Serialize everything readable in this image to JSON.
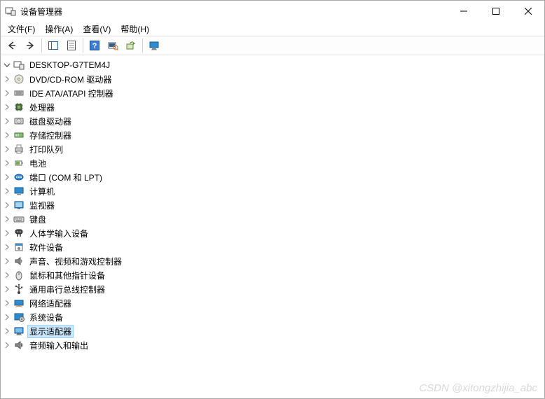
{
  "window": {
    "title": "设备管理器"
  },
  "menu": {
    "file": "文件(F)",
    "action": "操作(A)",
    "view": "查看(V)",
    "help": "帮助(H)"
  },
  "tree": {
    "root": "DESKTOP-G7TEM4J",
    "items": [
      {
        "label": "DVD/CD-ROM 驱动器",
        "icon": "disc"
      },
      {
        "label": "IDE ATA/ATAPI 控制器",
        "icon": "ide"
      },
      {
        "label": "处理器",
        "icon": "cpu"
      },
      {
        "label": "磁盘驱动器",
        "icon": "hdd"
      },
      {
        "label": "存储控制器",
        "icon": "storage"
      },
      {
        "label": "打印队列",
        "icon": "printer"
      },
      {
        "label": "电池",
        "icon": "battery"
      },
      {
        "label": "端口 (COM 和 LPT)",
        "icon": "port"
      },
      {
        "label": "计算机",
        "icon": "computer"
      },
      {
        "label": "监视器",
        "icon": "monitor"
      },
      {
        "label": "键盘",
        "icon": "keyboard"
      },
      {
        "label": "人体学输入设备",
        "icon": "hid"
      },
      {
        "label": "软件设备",
        "icon": "software"
      },
      {
        "label": "声音、视频和游戏控制器",
        "icon": "sound"
      },
      {
        "label": "鼠标和其他指针设备",
        "icon": "mouse"
      },
      {
        "label": "通用串行总线控制器",
        "icon": "usb"
      },
      {
        "label": "网络适配器",
        "icon": "network"
      },
      {
        "label": "系统设备",
        "icon": "system"
      },
      {
        "label": "显示适配器",
        "icon": "display",
        "selected": true
      },
      {
        "label": "音频输入和输出",
        "icon": "audio"
      }
    ]
  },
  "watermark": "CSDN @xitongzhijia_abc"
}
